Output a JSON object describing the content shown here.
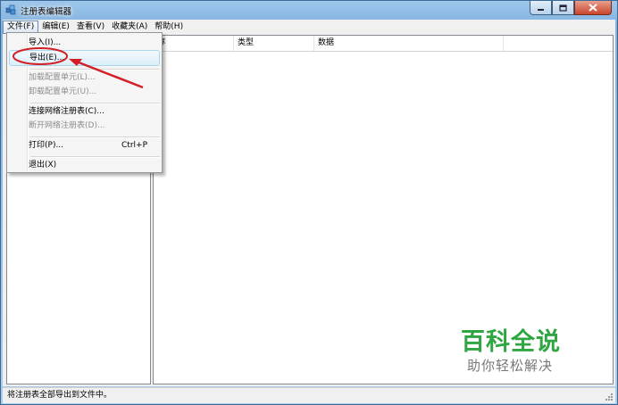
{
  "window": {
    "title": "注册表编辑器"
  },
  "menubar": [
    {
      "label": "文件(F)"
    },
    {
      "label": "编辑(E)"
    },
    {
      "label": "查看(V)"
    },
    {
      "label": "收藏夹(A)"
    },
    {
      "label": "帮助(H)"
    }
  ],
  "file_menu": {
    "items": [
      {
        "label": "导入(I)...",
        "enabled": true
      },
      {
        "label": "导出(E)...",
        "enabled": true,
        "highlighted": true
      },
      {
        "label": "加载配置单元(L)...",
        "enabled": false
      },
      {
        "label": "卸载配置单元(U)...",
        "enabled": false
      },
      {
        "label": "连接网络注册表(C)...",
        "enabled": true
      },
      {
        "label": "断开网络注册表(D)...",
        "enabled": false
      },
      {
        "label": "打印(P)...",
        "enabled": true,
        "shortcut": "Ctrl+P"
      },
      {
        "label": "退出(X)",
        "enabled": true
      }
    ]
  },
  "list": {
    "columns": [
      "名称",
      "类型",
      "数据"
    ],
    "first_column_visible": "称"
  },
  "statusbar": {
    "text": "将注册表全部导出到文件中。"
  },
  "watermark": {
    "title": "百科全说",
    "subtitle": "助你轻松解决"
  },
  "colors": {
    "annotation": "#d32027",
    "watermark_green": "#2fa642"
  },
  "icons": [
    "regedit-app-icon",
    "minimize-icon",
    "maximize-icon",
    "close-icon",
    "size-grip-icon"
  ]
}
